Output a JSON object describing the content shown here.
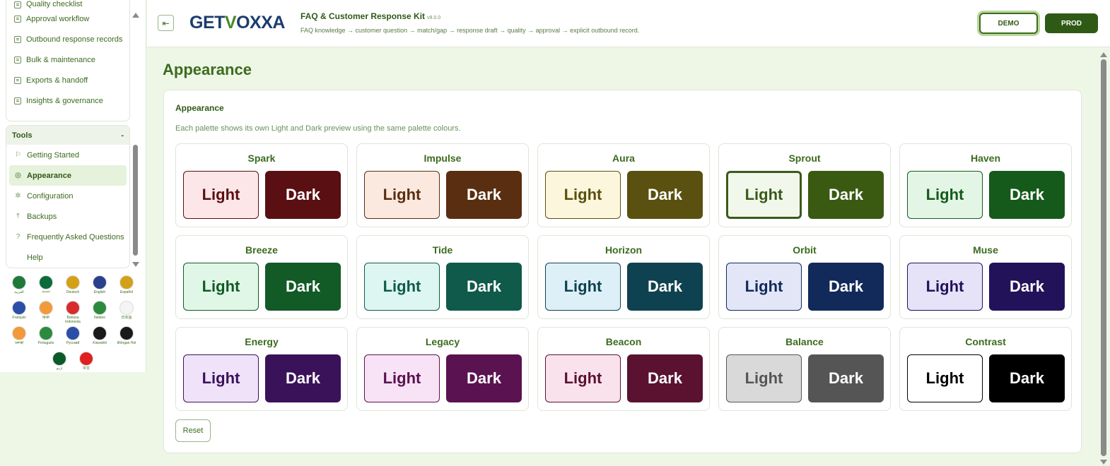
{
  "sidebar": {
    "nav_items": [
      {
        "label": "Quality checklist"
      },
      {
        "label": "Approval workflow"
      },
      {
        "label": "Outbound response records"
      },
      {
        "label": "Bulk & maintenance"
      },
      {
        "label": "Exports & handoff"
      },
      {
        "label": "Insights & governance"
      }
    ],
    "tools": {
      "header": "Tools",
      "collapse_glyph": "-",
      "items": [
        {
          "label": "Getting Started",
          "icon": "flag-icon"
        },
        {
          "label": "Appearance",
          "icon": "palette-icon"
        },
        {
          "label": "Configuration",
          "icon": "gear-icon"
        },
        {
          "label": "Backups",
          "icon": "upload-icon"
        },
        {
          "label": "Frequently Asked Questions",
          "icon": "question-icon"
        },
        {
          "label": "Help",
          "icon": ""
        }
      ]
    },
    "languages": [
      {
        "label": "العربية",
        "color": "#1f7a3a"
      },
      {
        "label": "বাংলা",
        "color": "#0b6b3a"
      },
      {
        "label": "Deutsch",
        "color": "#d4a017"
      },
      {
        "label": "English",
        "color": "#2b3f8c"
      },
      {
        "label": "Español",
        "color": "#d4a017"
      },
      {
        "label": "Français",
        "color": "#2b4fa8"
      },
      {
        "label": "हिन्दी",
        "color": "#f29a3a"
      },
      {
        "label": "Bahasa Indonesia",
        "color": "#d92b2b"
      },
      {
        "label": "Italiano",
        "color": "#2b8a3e"
      },
      {
        "label": "日本語",
        "color": "#f4f4f4"
      },
      {
        "label": "ਪੰਜਾਬੀ",
        "color": "#f29a3a"
      },
      {
        "label": "Português",
        "color": "#2b8a3e"
      },
      {
        "label": "Русский",
        "color": "#2b4fa8"
      },
      {
        "label": "Kiswahili",
        "color": "#1a1a1a"
      },
      {
        "label": "tlhIngan Hol",
        "color": "#1a1a1a"
      },
      {
        "label": "اردو",
        "color": "#0b5a2a"
      },
      {
        "label": "中文",
        "color": "#e02020"
      }
    ]
  },
  "header": {
    "logo_left": "GET",
    "logo_v": "V",
    "logo_right": "OXXA",
    "title": "FAQ & Customer Response Kit",
    "version": "v9.0.0",
    "subtitle": "FAQ knowledge → customer question → match/gap → response draft → quality → approval → explicit outbound record.",
    "demo_label": "DEMO",
    "prod_label": "PROD"
  },
  "main": {
    "page_title": "Appearance",
    "card_title": "Appearance",
    "card_desc": "Each palette shows its own Light and Dark preview using the same palette colours.",
    "light_label": "Light",
    "dark_label": "Dark",
    "reset_label": "Reset",
    "palettes": [
      {
        "name": "Spark",
        "light_bg": "#fde6e8",
        "light_fg": "#5a0f12",
        "dark_bg": "#5a0f12"
      },
      {
        "name": "Impulse",
        "light_bg": "#fbe9df",
        "light_fg": "#5a2e10",
        "dark_bg": "#5a2e10"
      },
      {
        "name": "Aura",
        "light_bg": "#fbf6dc",
        "light_fg": "#5a500f",
        "dark_bg": "#5a500f"
      },
      {
        "name": "Sprout",
        "light_bg": "#f1f7ea",
        "light_fg": "#3a5a1a",
        "dark_bg": "#3a5a12",
        "selected": true
      },
      {
        "name": "Haven",
        "light_bg": "#e3f6e6",
        "light_fg": "#155a1a",
        "dark_bg": "#155a1a"
      },
      {
        "name": "Breeze",
        "light_bg": "#e0f7e8",
        "light_fg": "#125a26",
        "dark_bg": "#125a26"
      },
      {
        "name": "Tide",
        "light_bg": "#ddf6f1",
        "light_fg": "#0f5a4a",
        "dark_bg": "#0f5a4a"
      },
      {
        "name": "Horizon",
        "light_bg": "#def0f7",
        "light_fg": "#0f4250",
        "dark_bg": "#0f4250"
      },
      {
        "name": "Orbit",
        "light_bg": "#e2e6f7",
        "light_fg": "#122a5a",
        "dark_bg": "#122a5a"
      },
      {
        "name": "Muse",
        "light_bg": "#e6e2f7",
        "light_fg": "#22125a",
        "dark_bg": "#22125a"
      },
      {
        "name": "Energy",
        "light_bg": "#efe2f9",
        "light_fg": "#3a125a",
        "dark_bg": "#3a125a"
      },
      {
        "name": "Legacy",
        "light_bg": "#f8e2f5",
        "light_fg": "#5a1250",
        "dark_bg": "#5a1250"
      },
      {
        "name": "Beacon",
        "light_bg": "#fae2ec",
        "light_fg": "#5a1230",
        "dark_bg": "#5a1230"
      },
      {
        "name": "Balance",
        "light_bg": "#d9d9d9",
        "light_fg": "#555555",
        "dark_bg": "#555555"
      },
      {
        "name": "Contrast",
        "light_bg": "#ffffff",
        "light_fg": "#000000",
        "dark_bg": "#000000"
      }
    ]
  }
}
